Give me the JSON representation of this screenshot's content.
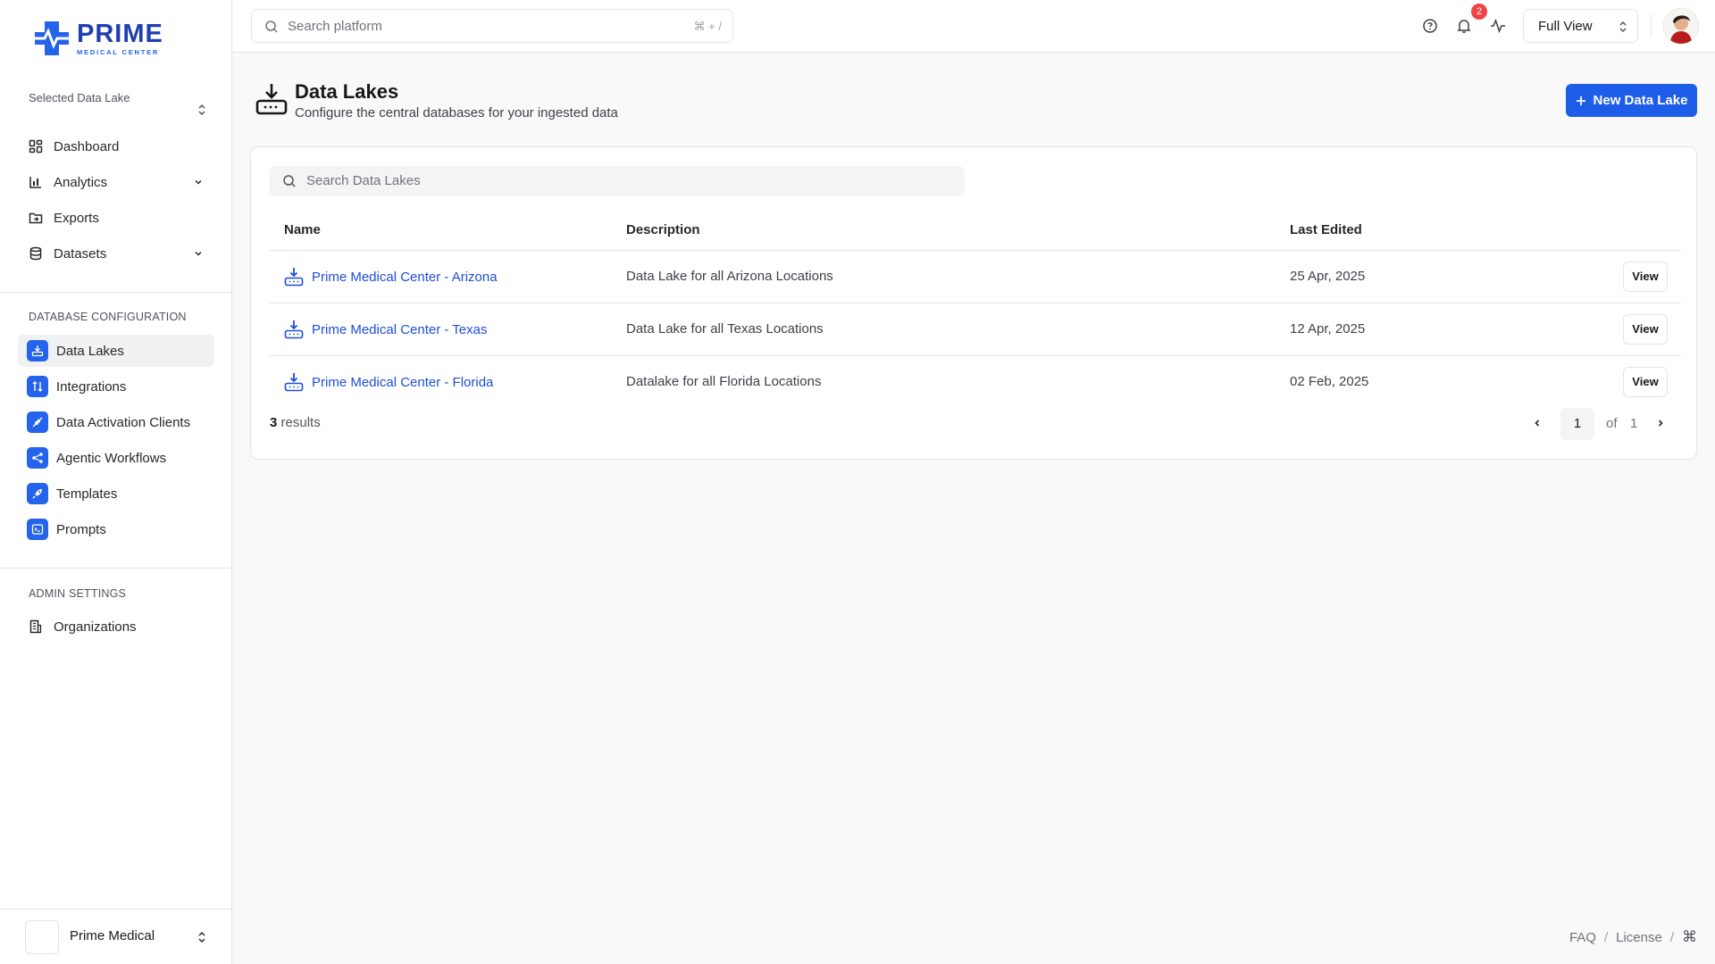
{
  "brand": {
    "name": "PRIME",
    "tagline": "MEDICAL CENTER",
    "primary_color": "#2563eb",
    "dark_color": "#1e40af"
  },
  "sidebar": {
    "selector_label": "Selected Data Lake",
    "main_nav": [
      {
        "label": "Dashboard",
        "icon": "dashboard-icon"
      },
      {
        "label": "Analytics",
        "icon": "bar-chart-icon",
        "expandable": true
      },
      {
        "label": "Exports",
        "icon": "folder-export-icon"
      },
      {
        "label": "Datasets",
        "icon": "database-icon",
        "expandable": true
      }
    ],
    "db_section_label": "DATABASE CONFIGURATION",
    "db_nav": [
      {
        "label": "Data Lakes",
        "icon": "download-tray-icon",
        "active": true
      },
      {
        "label": "Integrations",
        "icon": "arrows-updown-icon"
      },
      {
        "label": "Data Activation Clients",
        "icon": "plug-icon"
      },
      {
        "label": "Agentic Workflows",
        "icon": "workflow-icon"
      },
      {
        "label": "Templates",
        "icon": "rocket-icon"
      },
      {
        "label": "Prompts",
        "icon": "terminal-icon"
      }
    ],
    "admin_section_label": "ADMIN SETTINGS",
    "admin_nav": [
      {
        "label": "Organizations",
        "icon": "building-icon"
      }
    ],
    "org_switcher": {
      "name": "Prime Medical"
    }
  },
  "topbar": {
    "search_placeholder": "Search platform",
    "search_shortcut": "⌘ + /",
    "notification_count": "2",
    "view_select": "Full View"
  },
  "page": {
    "title": "Data Lakes",
    "subtitle": "Configure the central databases for your ingested data",
    "new_button": "New Data Lake"
  },
  "table": {
    "search_placeholder": "Search Data Lakes",
    "columns": [
      "Name",
      "Description",
      "Last Edited"
    ],
    "rows": [
      {
        "name": "Prime Medical Center - Arizona",
        "description": "Data Lake for all Arizona Locations",
        "last_edited": "25 Apr, 2025",
        "action": "View"
      },
      {
        "name": "Prime Medical Center - Texas",
        "description": "Data Lake for all Texas Locations",
        "last_edited": "12 Apr, 2025",
        "action": "View"
      },
      {
        "name": "Prime Medical Center - Florida",
        "description": "Datalake for all Florida Locations",
        "last_edited": "02 Feb, 2025",
        "action": "View"
      }
    ],
    "results_count": "3",
    "results_label": "results",
    "pagination": {
      "current": "1",
      "of_label": "of",
      "total": "1"
    }
  },
  "footer": {
    "links": [
      "FAQ",
      "License"
    ],
    "shortcut_icon": "⌘"
  }
}
